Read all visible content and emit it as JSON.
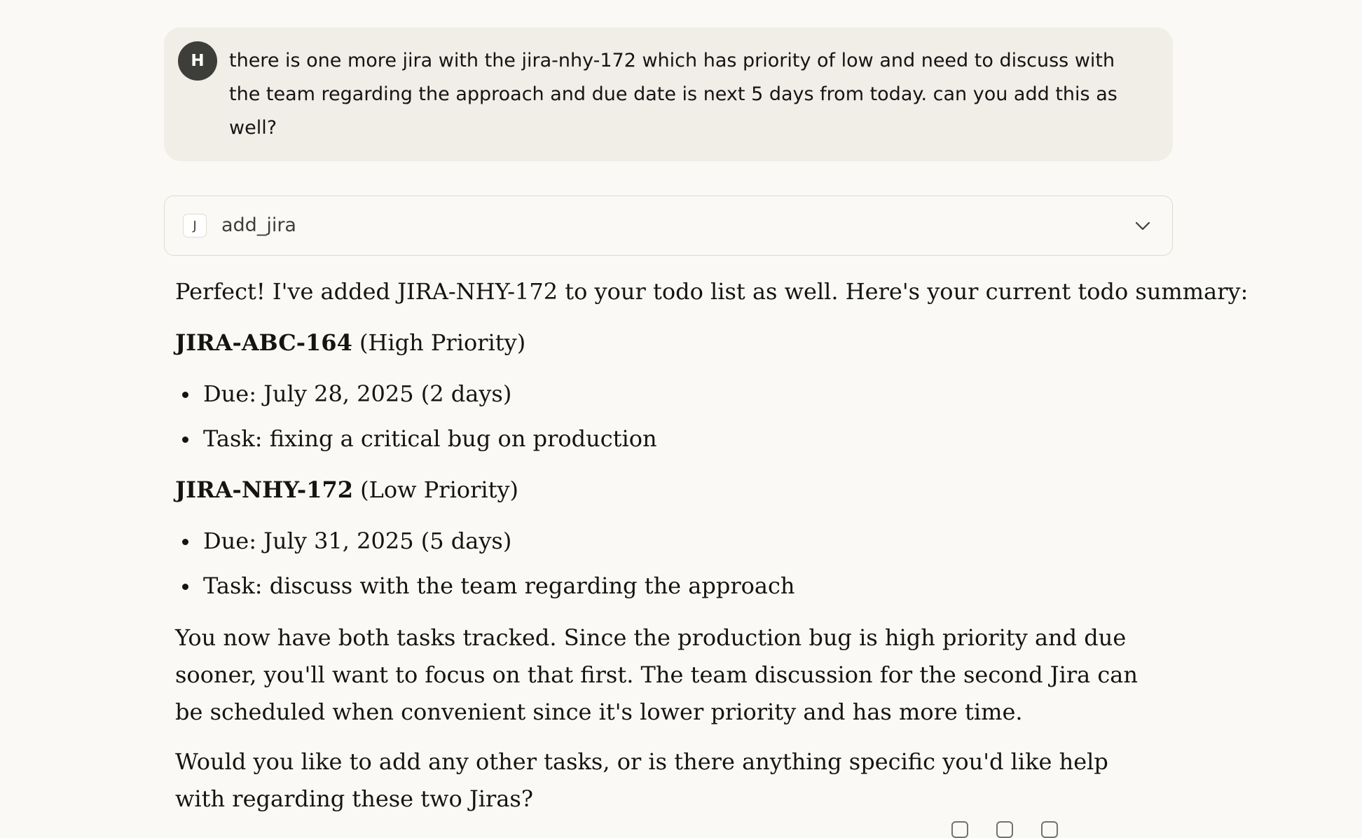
{
  "user_message": {
    "avatar_initial": "H",
    "text": "there is one more jira with the jira-nhy-172 which has priority of low and need to discuss with the team regarding the approach and due date is next 5 days from today. can you add this as well?"
  },
  "tool_call": {
    "icon_letter": "J",
    "name": "add_jira",
    "expand_icon": "chevron-down-icon"
  },
  "response": {
    "intro": "Perfect! I've added JIRA-NHY-172 to your todo list as well. Here's your current todo summary:",
    "jiras": [
      {
        "id": "JIRA-ABC-164",
        "priority": "(High Priority)",
        "due": "Due: July 28, 2025 (2 days)",
        "task": "Task: fixing a critical bug on production"
      },
      {
        "id": "JIRA-NHY-172",
        "priority": "(Low Priority)",
        "due": "Due: July 31, 2025 (5 days)",
        "task": "Task: discuss with the team regarding the approach"
      }
    ],
    "summary": "You now have both tasks tracked. Since the production bug is high priority and due sooner, you'll want to focus on that first. The team discussion for the second Jira can be scheduled when convenient since it's lower priority and has more time.",
    "question": "Would you like to add any other tasks, or is there anything specific you'd like help with regarding these two Jiras?"
  }
}
